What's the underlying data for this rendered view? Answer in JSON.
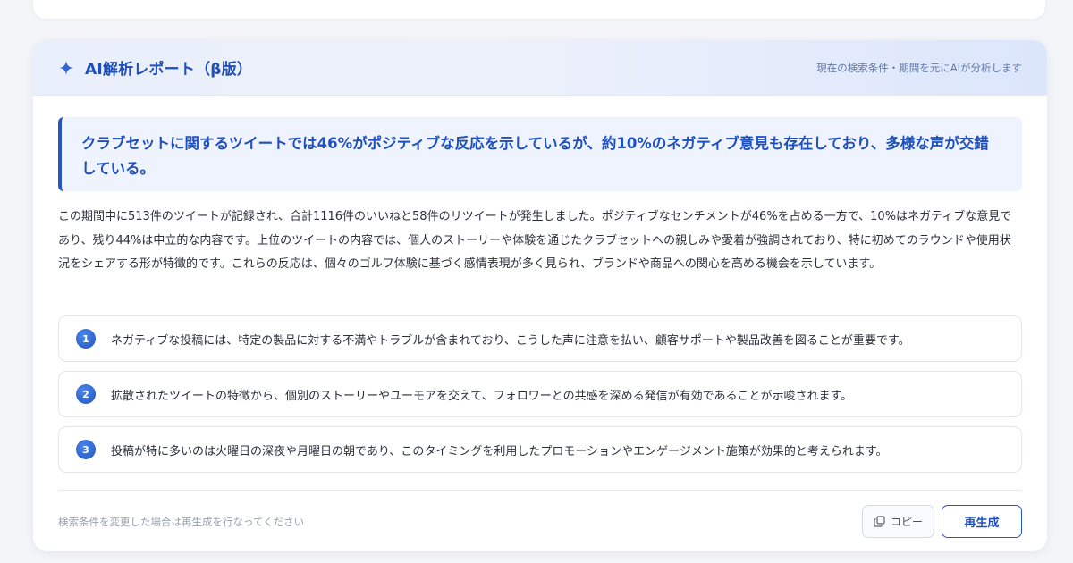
{
  "report": {
    "title": "AI解析レポート（β版）",
    "header_note": "現在の検索条件・期間を元にAIが分析します",
    "summary": "クラブセットに関するツイートでは46%がポジティブな反応を示しているが、約10%のネガティブ意見も存在しており、多様な声が交錯している。",
    "body": "この期間中に513件のツイートが記録され、合計1116件のいいねと58件のリツイートが発生しました。ポジティブなセンチメントが46%を占める一方で、10%はネガティブな意見であり、残り44%は中立的な内容です。上位のツイートの内容では、個人のストーリーや体験を通じたクラブセットへの親しみや愛着が強調されており、特に初めてのラウンドや使用状況をシェアする形が特徴的です。これらの反応は、個々のゴルフ体験に基づく感情表現が多く見られ、ブランドや商品への関心を高める機会を示しています。",
    "points": [
      {
        "num": "1",
        "text": "ネガティブな投稿には、特定の製品に対する不満やトラブルが含まれており、こうした声に注意を払い、顧客サポートや製品改善を図ることが重要です。"
      },
      {
        "num": "2",
        "text": "拡散されたツイートの特徴から、個別のストーリーやユーモアを交えて、フォロワーとの共感を深める発信が有効であることが示唆されます。"
      },
      {
        "num": "3",
        "text": "投稿が特に多いのは火曜日の深夜や月曜日の朝であり、このタイミングを利用したプロモーションやエンゲージメント施策が効果的と考えられます。"
      }
    ],
    "footer_note": "検索条件を変更した場合は再生成を行なってください",
    "copy_label": "コピー",
    "regenerate_label": "再生成"
  },
  "icons": {
    "header": "sparkle-icon",
    "copy": "copy-icon"
  },
  "colors": {
    "accent": "#1f4fb8",
    "summary_bg": "#eff3fd",
    "background": "#f4f5f9"
  }
}
